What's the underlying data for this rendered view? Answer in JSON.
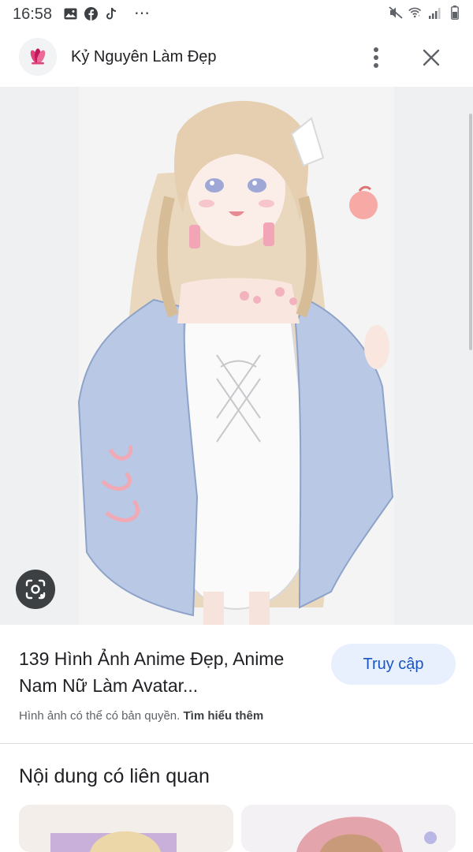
{
  "status_bar": {
    "time": "16:58",
    "overflow": "⋯",
    "left_icons": [
      "gallery-icon",
      "facebook-icon",
      "tiktok-icon"
    ],
    "right_icons": [
      "mute-icon",
      "wifi-icon",
      "signal-icon",
      "battery-icon"
    ]
  },
  "header": {
    "site_name": "Kỷ Nguyên Làm Đẹp",
    "logo_icon": "flower-logo-icon",
    "more_icon": "more-vert-icon",
    "close_icon": "close-icon"
  },
  "image": {
    "description_icon": "anime-girl-illustration",
    "lens_icon": "lens-icon"
  },
  "result": {
    "title": "139 Hình Ảnh Anime Đẹp, Anime Nam Nữ Làm Avatar...",
    "visit_label": "Truy cập",
    "copyright_text": "Hình ảnh có thể có bản quyền.",
    "learn_more": "Tìm hiểu thêm"
  },
  "related": {
    "heading": "Nội dung có liên quan"
  },
  "colors": {
    "accent": "#1a56c2",
    "visit_bg": "#e8f0fe",
    "lens_bg": "#3c4043",
    "logo_pink": "#e0437a"
  }
}
